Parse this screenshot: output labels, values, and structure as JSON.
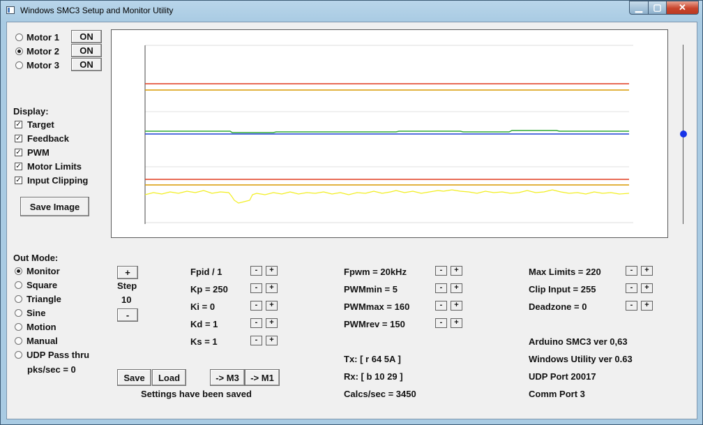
{
  "window": {
    "title": "Windows SMC3 Setup and Monitor Utility",
    "minimize": "▁",
    "maximize": "▢",
    "close": "✕"
  },
  "motors": [
    {
      "label": "Motor 1",
      "selected": false,
      "button": "ON"
    },
    {
      "label": "Motor 2",
      "selected": true,
      "button": "ON"
    },
    {
      "label": "Motor 3",
      "selected": false,
      "button": "ON"
    }
  ],
  "display": {
    "heading": "Display:",
    "items": [
      "Target",
      "Feedback",
      "PWM",
      "Motor Limits",
      "Input Clipping"
    ],
    "save_image": "Save Image"
  },
  "out_mode": {
    "heading": "Out Mode:",
    "items": [
      "Monitor",
      "Square",
      "Triangle",
      "Sine",
      "Motion",
      "Manual",
      "UDP Pass thru"
    ],
    "selected": "Monitor",
    "pks": "pks/sec = 0"
  },
  "step": {
    "plus": "+",
    "label": "Step",
    "value": "10",
    "minus": "-"
  },
  "pid": [
    "Fpid / 1",
    "Kp = 250",
    "Ki = 0",
    "Kd = 1",
    "Ks = 1"
  ],
  "pwm": [
    "Fpwm = 20kHz",
    "PWMmin = 5",
    "PWMmax = 160",
    "PWMrev = 150"
  ],
  "limits": [
    "Max Limits = 220",
    "Clip Input = 255",
    "Deadzone = 0"
  ],
  "buttons": {
    "save": "Save",
    "load": "Load",
    "to_m3": "-> M3",
    "to_m1": "-> M1",
    "minus": "-",
    "plus": "+"
  },
  "status": "Settings have been saved",
  "comms": {
    "tx": "Tx: [ r 64 5A ]",
    "rx": "Rx: [ b 10 29 ]",
    "calcs": "Calcs/sec = 3450"
  },
  "info": [
    "Arduino SMC3 ver 0,63",
    "Windows Utility ver 0.63",
    "UDP Port 20017",
    "Comm Port 3"
  ],
  "colors": {
    "limit": "#e03a1e",
    "clip": "#d89a00",
    "target": "#1a3fd4",
    "feedback": "#2ea833",
    "pwm": "#f2ee1f",
    "slider": "#1733e8"
  }
}
